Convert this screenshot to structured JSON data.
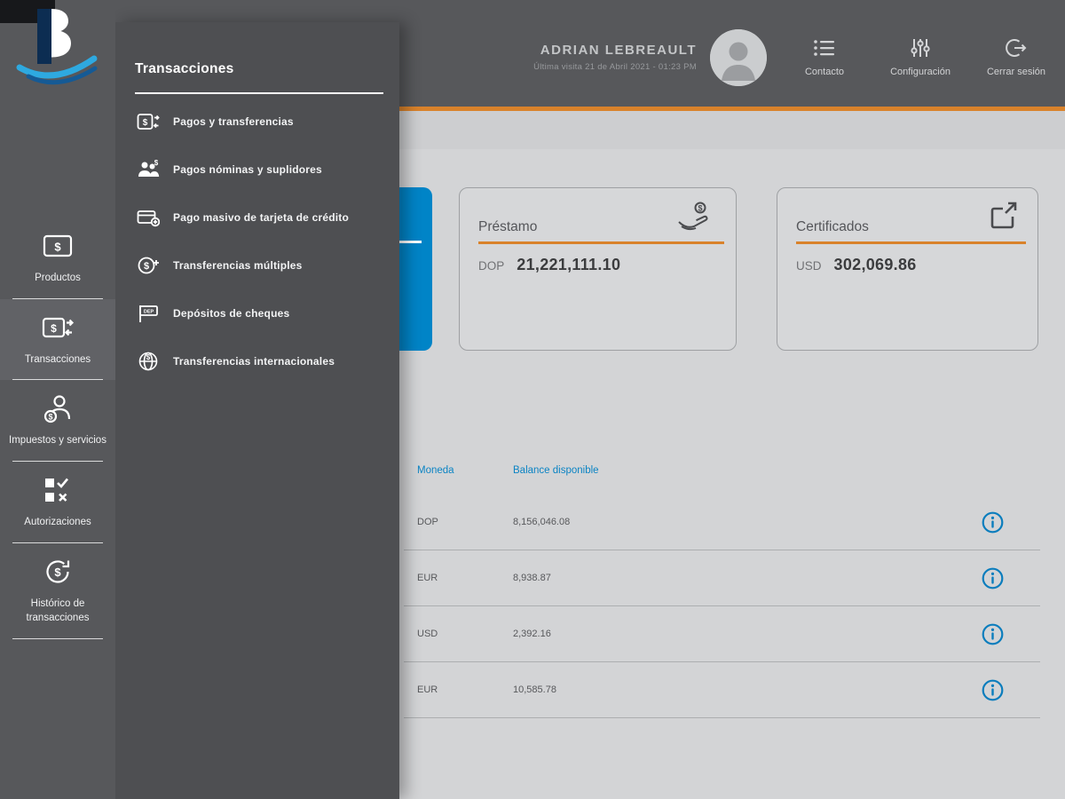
{
  "brand": {
    "logo": "banreservas-b-logo"
  },
  "header": {
    "user": {
      "name": "ADRIAN LEBREAULT",
      "last_visit": "Última visita 21 de Abril 2021 - 01:23 PM"
    },
    "actions": {
      "contact": {
        "label": "Contacto",
        "icon": "contact-list-icon"
      },
      "settings": {
        "label": "Configuración",
        "icon": "settings-sliders-icon"
      },
      "logout": {
        "label": "Cerrar sesión",
        "icon": "logout-icon"
      }
    }
  },
  "sidebar": {
    "items": [
      {
        "label": "Productos",
        "icon": "products-icon",
        "active": false
      },
      {
        "label": "Transacciones",
        "icon": "transactions-icon",
        "active": true
      },
      {
        "label": "Impuestos y servicios",
        "icon": "taxes-services-icon",
        "active": false
      },
      {
        "label": "Autorizaciones",
        "icon": "authorizations-icon",
        "active": false
      },
      {
        "label": "Histórico de transacciones",
        "icon": "transaction-history-icon",
        "active": false
      }
    ]
  },
  "submenu": {
    "title": "Transacciones",
    "items": [
      {
        "label": "Pagos y transferencias",
        "icon": "payments-transfers-icon"
      },
      {
        "label": "Pagos nóminas y suplidores",
        "icon": "payroll-suppliers-icon"
      },
      {
        "label": "Pago masivo de tarjeta de crédito",
        "icon": "credit-card-bulk-icon"
      },
      {
        "label": "Transferencias múltiples",
        "icon": "multiple-transfers-icon"
      },
      {
        "label": "Depósitos de cheques",
        "icon": "check-deposit-icon"
      },
      {
        "label": "Transferencias internacionales",
        "icon": "international-transfers-icon"
      }
    ]
  },
  "summary_cards": [
    {
      "title": "Préstamo",
      "currency": "DOP",
      "amount": "21,221,111.10",
      "icon": "loan-hand-icon"
    },
    {
      "title": "Certificados",
      "currency": "USD",
      "amount": "302,069.86",
      "icon": "external-link-icon"
    }
  ],
  "accounts_table": {
    "columns": {
      "currency": "Moneda",
      "balance": "Balance disponible"
    },
    "rows": [
      {
        "currency": "DOP",
        "balance": "8,156,046.08"
      },
      {
        "currency": "EUR",
        "balance": "8,938.87"
      },
      {
        "currency": "USD",
        "balance": "2,392.16"
      },
      {
        "currency": "EUR",
        "balance": "10,585.78"
      }
    ]
  },
  "colors": {
    "accent_orange": "#d9822b",
    "accent_blue": "#0b84c4",
    "active_card_blue": "#0084c7"
  }
}
